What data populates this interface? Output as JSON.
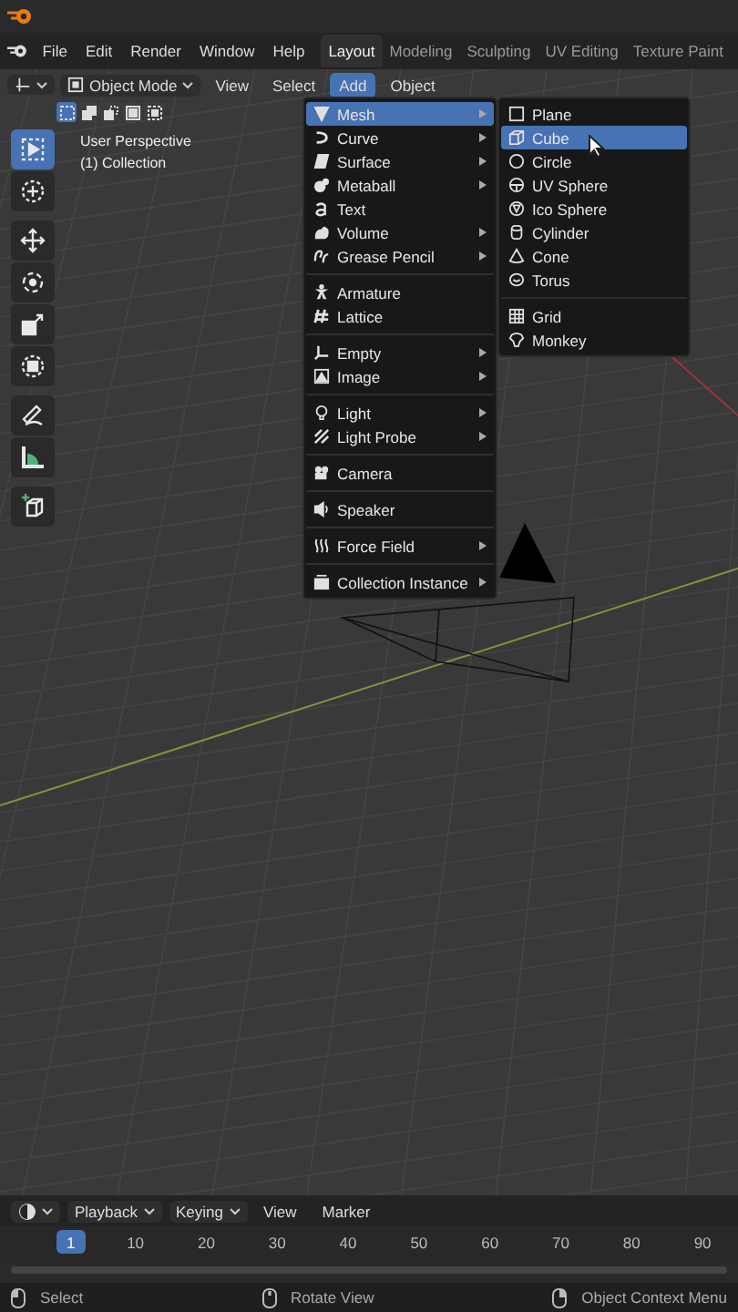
{
  "menu_bar": {
    "menus": [
      "File",
      "Edit",
      "Render",
      "Window",
      "Help"
    ]
  },
  "workspace_tabs": [
    {
      "label": "Layout",
      "selected": true
    },
    {
      "label": "Modeling",
      "selected": false
    },
    {
      "label": "Sculpting",
      "selected": false
    },
    {
      "label": "UV Editing",
      "selected": false
    },
    {
      "label": "Texture Paint",
      "selected": false
    }
  ],
  "header": {
    "mode": "Object Mode",
    "menus": [
      {
        "label": "View",
        "selected": false
      },
      {
        "label": "Select",
        "selected": false
      },
      {
        "label": "Add",
        "selected": true
      },
      {
        "label": "Object",
        "selected": false
      }
    ]
  },
  "selection_modes": [
    {
      "kind": "set",
      "selected": true
    },
    {
      "kind": "extend",
      "selected": false
    },
    {
      "kind": "subtract",
      "selected": false
    },
    {
      "kind": "invert",
      "selected": false
    },
    {
      "kind": "intersect",
      "selected": false
    }
  ],
  "toolbar": [
    {
      "kind": "select",
      "selected": true
    },
    {
      "kind": "cursor",
      "selected": false
    },
    {
      "kind": "move",
      "selected": false
    },
    {
      "kind": "rotate",
      "selected": false
    },
    {
      "kind": "scale",
      "selected": false
    },
    {
      "kind": "transform",
      "selected": false
    },
    {
      "kind": "annotate",
      "selected": false
    },
    {
      "kind": "measure",
      "selected": false
    },
    {
      "kind": "add-cube",
      "selected": false
    }
  ],
  "viewport_overlay": {
    "perspective": "User Perspective",
    "collection": "(1) Collection"
  },
  "add_menu": {
    "groups": [
      [
        {
          "label": "Mesh",
          "kind": "mesh",
          "submenu": true,
          "selected": true
        },
        {
          "label": "Curve",
          "kind": "curve",
          "submenu": true,
          "selected": false
        },
        {
          "label": "Surface",
          "kind": "surface",
          "submenu": true,
          "selected": false
        },
        {
          "label": "Metaball",
          "kind": "metaball",
          "submenu": true,
          "selected": false
        },
        {
          "label": "Text",
          "kind": "text",
          "submenu": false,
          "selected": false
        },
        {
          "label": "Volume",
          "kind": "volume",
          "submenu": true,
          "selected": false
        },
        {
          "label": "Grease Pencil",
          "kind": "grease",
          "submenu": true,
          "selected": false
        }
      ],
      [
        {
          "label": "Armature",
          "kind": "armature",
          "submenu": false,
          "selected": false
        },
        {
          "label": "Lattice",
          "kind": "lattice",
          "submenu": false,
          "selected": false
        }
      ],
      [
        {
          "label": "Empty",
          "kind": "empty",
          "submenu": true,
          "selected": false
        },
        {
          "label": "Image",
          "kind": "image",
          "submenu": true,
          "selected": false
        }
      ],
      [
        {
          "label": "Light",
          "kind": "light",
          "submenu": true,
          "selected": false
        },
        {
          "label": "Light Probe",
          "kind": "probe",
          "submenu": true,
          "selected": false
        }
      ],
      [
        {
          "label": "Camera",
          "kind": "camera",
          "submenu": false,
          "selected": false
        }
      ],
      [
        {
          "label": "Speaker",
          "kind": "speaker",
          "submenu": false,
          "selected": false
        }
      ],
      [
        {
          "label": "Force Field",
          "kind": "force",
          "submenu": true,
          "selected": false
        }
      ],
      [
        {
          "label": "Collection Instance",
          "kind": "collection",
          "submenu": true,
          "selected": false
        }
      ]
    ]
  },
  "mesh_submenu": {
    "groups": [
      [
        {
          "label": "Plane",
          "kind": "plane",
          "selected": false
        },
        {
          "label": "Cube",
          "kind": "cube",
          "selected": true
        },
        {
          "label": "Circle",
          "kind": "circle",
          "selected": false
        },
        {
          "label": "UV Sphere",
          "kind": "uvsphere",
          "selected": false
        },
        {
          "label": "Ico Sphere",
          "kind": "icosphere",
          "selected": false
        },
        {
          "label": "Cylinder",
          "kind": "cylinder",
          "selected": false
        },
        {
          "label": "Cone",
          "kind": "cone",
          "selected": false
        },
        {
          "label": "Torus",
          "kind": "torus",
          "selected": false
        }
      ],
      [
        {
          "label": "Grid",
          "kind": "grid",
          "selected": false
        },
        {
          "label": "Monkey",
          "kind": "monkey",
          "selected": false
        }
      ]
    ]
  },
  "timeline": {
    "menus": [
      {
        "label": "Playback",
        "dropdown": true
      },
      {
        "label": "Keying",
        "dropdown": true
      },
      {
        "label": "View",
        "dropdown": false
      },
      {
        "label": "Marker",
        "dropdown": false
      }
    ],
    "current_frame": "1",
    "ticks": [
      "10",
      "20",
      "30",
      "40",
      "50",
      "60",
      "70",
      "80",
      "90"
    ]
  },
  "status_bar": [
    {
      "label": "Select",
      "kind": "left"
    },
    {
      "label": "Rotate View",
      "kind": "middle"
    },
    {
      "label": "Object Context Menu",
      "kind": "right"
    }
  ]
}
